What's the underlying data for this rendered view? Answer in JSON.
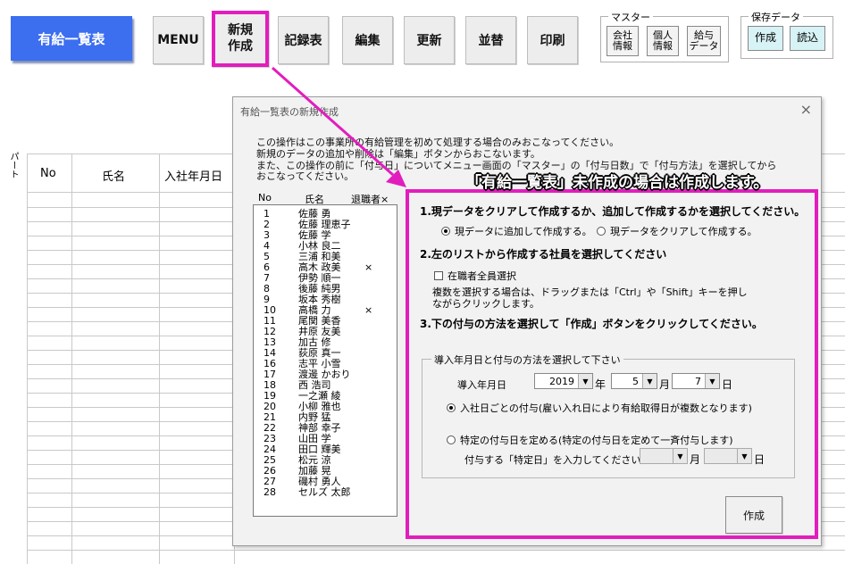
{
  "toolbar": {
    "title_button": "有給一覧表",
    "buttons": [
      "MENU",
      "新規作成",
      "記録表",
      "編集",
      "更新",
      "並替",
      "印刷"
    ],
    "new_button_line1": "新規",
    "new_button_line2": "作成"
  },
  "master_group": {
    "label": "マスター",
    "buttons": [
      {
        "line1": "会社",
        "line2": "情報"
      },
      {
        "line1": "個人",
        "line2": "情報"
      },
      {
        "line1": "給与",
        "line2": "データ"
      }
    ]
  },
  "save_group": {
    "label": "保存データ",
    "buttons": [
      "作成",
      "読込"
    ]
  },
  "sheet": {
    "vertical_header": "パート",
    "columns": [
      "No",
      "氏名",
      "入社年月日"
    ]
  },
  "dialog": {
    "title": "有給一覧表の新規作成",
    "close_symbol": "×",
    "intro": [
      "この操作はこの事業所の有給管理を初めて処理する場合のみおこなってください。",
      "新規のデータの追加や削除は「編集」ボタンからおこないます。",
      "また、この操作の前に「付与日」についてメニュー画面の「マスター」の「付与日数」で「付与方法」を選択してから",
      "おこなってください。"
    ],
    "list_headers": {
      "no": "No",
      "name": "氏名",
      "retired": "退職者×"
    },
    "employees": [
      {
        "no": "1",
        "name": "佐藤 勇",
        "retired": ""
      },
      {
        "no": "2",
        "name": "佐藤 理恵子",
        "retired": ""
      },
      {
        "no": "3",
        "name": "佐藤 学",
        "retired": ""
      },
      {
        "no": "4",
        "name": "小林 良二",
        "retired": ""
      },
      {
        "no": "5",
        "name": "三浦 和美",
        "retired": ""
      },
      {
        "no": "6",
        "name": "高木 政美",
        "retired": "×"
      },
      {
        "no": "7",
        "name": "伊勢 順一",
        "retired": ""
      },
      {
        "no": "8",
        "name": "後藤 純男",
        "retired": ""
      },
      {
        "no": "9",
        "name": "坂本 秀樹",
        "retired": ""
      },
      {
        "no": "10",
        "name": "高橋 力",
        "retired": "×"
      },
      {
        "no": "11",
        "name": "尾関 美香",
        "retired": ""
      },
      {
        "no": "12",
        "name": "井原 友美",
        "retired": ""
      },
      {
        "no": "13",
        "name": "加古 修",
        "retired": ""
      },
      {
        "no": "14",
        "name": "荻原 真一",
        "retired": ""
      },
      {
        "no": "16",
        "name": "志平 小雪",
        "retired": ""
      },
      {
        "no": "17",
        "name": "渡邊 かおり",
        "retired": ""
      },
      {
        "no": "18",
        "name": "西 浩司",
        "retired": ""
      },
      {
        "no": "19",
        "name": "一之瀬 綾",
        "retired": ""
      },
      {
        "no": "20",
        "name": "小柳 雅也",
        "retired": ""
      },
      {
        "no": "21",
        "name": "内野 猛",
        "retired": ""
      },
      {
        "no": "22",
        "name": "神部 幸子",
        "retired": ""
      },
      {
        "no": "23",
        "name": "山田 学",
        "retired": ""
      },
      {
        "no": "24",
        "name": "田口 輝美",
        "retired": ""
      },
      {
        "no": "25",
        "name": "松元 涼",
        "retired": ""
      },
      {
        "no": "26",
        "name": "加藤 晃",
        "retired": ""
      },
      {
        "no": "27",
        "name": "磯村 勇人",
        "retired": ""
      },
      {
        "no": "28",
        "name": "セルズ 太郎",
        "retired": ""
      }
    ],
    "step1": "1.現データをクリアして作成するか、追加して作成するかを選択してください。",
    "step1_opt_add": "現データに追加して作成する。",
    "step1_opt_clear": "現データをクリアして作成する。",
    "step2": "2.左のリストから作成する社員を選択してください",
    "step2_check": "在職者全員選択",
    "step2_note1": "複数を選択する場合は、ドラッグまたは「Ctrl」や「Shift」キーを押し",
    "step2_note2": "ながらクリックします。",
    "step3": "3.下の付与の方法を選択して「作成」ボタンをクリックしてください。",
    "method_group_label": "導入年月日と付与の方法を選択して下さい",
    "intro_date_label": "導入年月日",
    "year": "2019",
    "year_unit": "年",
    "month": "5",
    "month_unit": "月",
    "day": "7",
    "day_unit": "日",
    "opt_hire_date": "入社日ごとの付与(雇い入れ日により有給取得日が複数となります)",
    "opt_fixed_date": "特定の付与日を定める(特定の付与日を定めて一斉付与します)",
    "fixed_date_prompt": "付与する「特定日」を入力してください。",
    "fixed_month_unit": "月",
    "fixed_day_unit": "日",
    "create_button": "作成"
  },
  "annotation": {
    "callout": "「有給一覧表」未作成の場合は作成します。",
    "highlight_color": "#e21dbd"
  },
  "colors": {
    "title_button": "#3c6ef0",
    "highlight": "#e21dbd",
    "dialog_bg": "#f2f2f2"
  }
}
